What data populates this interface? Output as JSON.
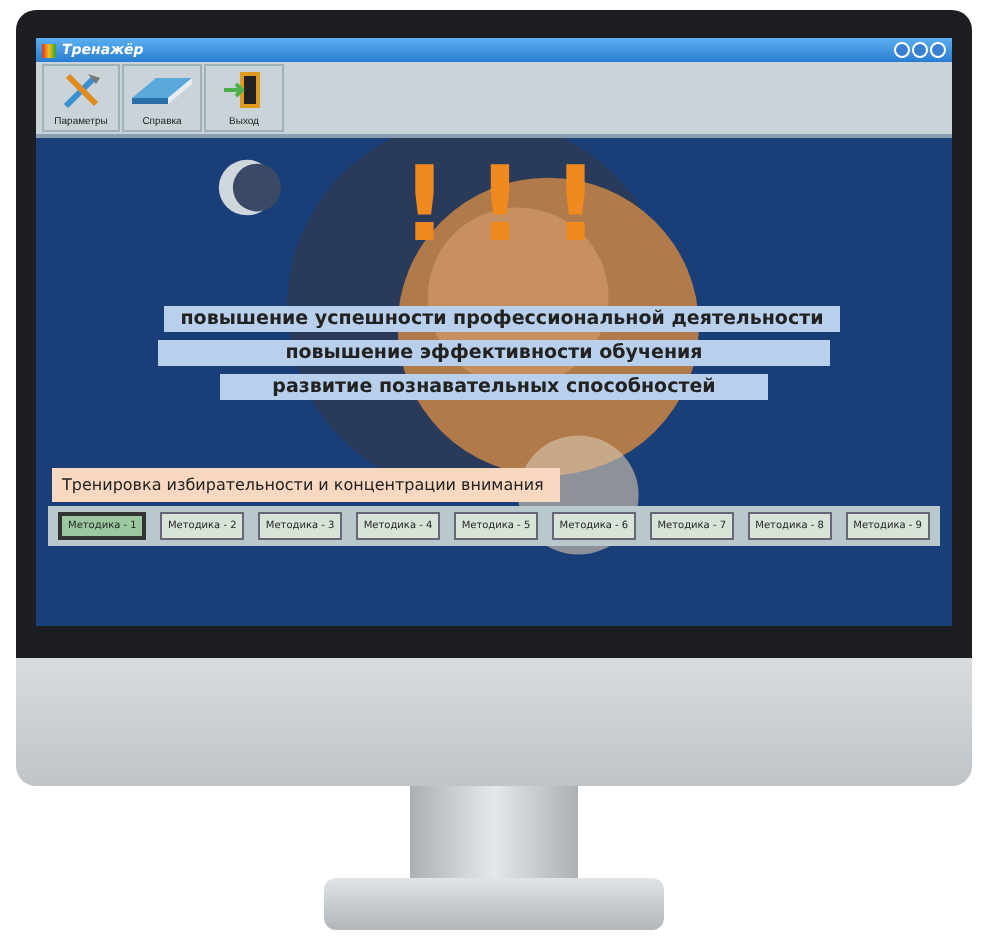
{
  "window": {
    "title": "Тренажёр"
  },
  "toolbar": [
    {
      "label": "Параметры",
      "kind": "tools"
    },
    {
      "label": "Справка",
      "kind": "book"
    },
    {
      "label": "Выход",
      "kind": "exit"
    }
  ],
  "headline": "!!!",
  "banners": [
    "повышение успешности профессиональной деятельности",
    "повышение эффективности обучения",
    "развитие познавательных способностей"
  ],
  "caption": "Тренировка избирательности и концентрации внимания",
  "methods": [
    {
      "label": "Методика - 1",
      "selected": true
    },
    {
      "label": "Методика - 2",
      "selected": false
    },
    {
      "label": "Методика - 3",
      "selected": false
    },
    {
      "label": "Методика - 4",
      "selected": false
    },
    {
      "label": "Методика - 5",
      "selected": false
    },
    {
      "label": "Методика - 6",
      "selected": false
    },
    {
      "label": "Методика - 7",
      "selected": false
    },
    {
      "label": "Методика - 8",
      "selected": false
    },
    {
      "label": "Методика - 9",
      "selected": false
    }
  ]
}
